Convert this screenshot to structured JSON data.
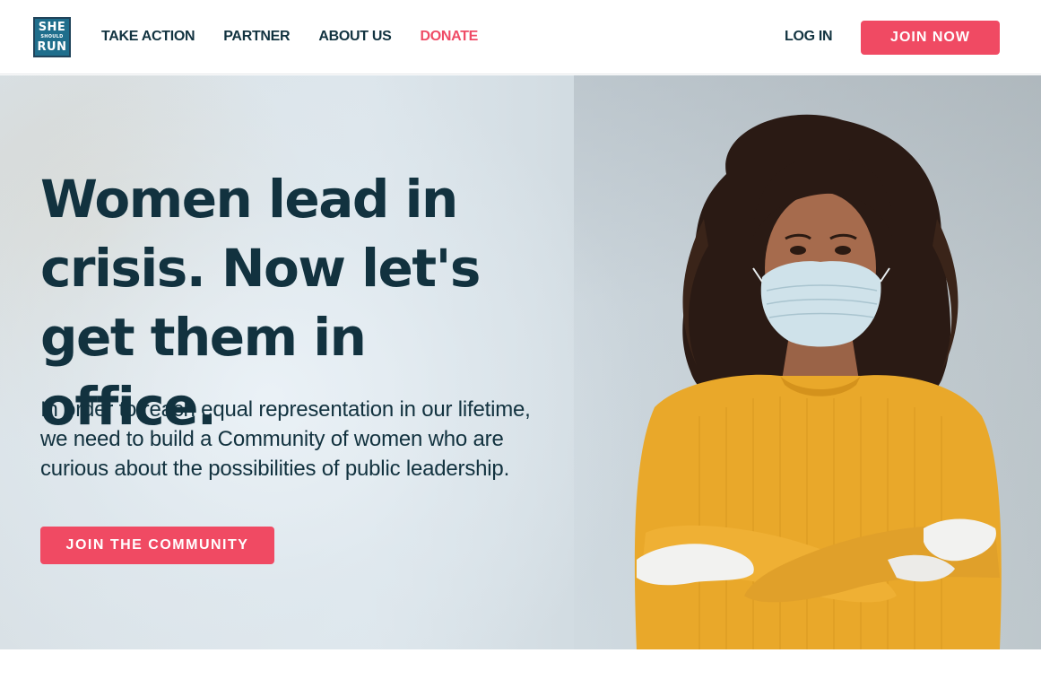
{
  "logo": {
    "line1": "SHE",
    "line2": "SHOULD",
    "line3": "RUN"
  },
  "nav": {
    "take_action": "TAKE ACTION",
    "partner": "PARTNER",
    "about_us": "ABOUT US",
    "donate": "DONATE"
  },
  "header": {
    "login": "LOG IN",
    "join_now": "JOIN NOW"
  },
  "hero": {
    "headline": "Women lead in crisis. Now let's get them in office.",
    "subtext": "In order to reach equal representation in our lifetime, we need to build a Community of women who are curious about the possibilities of public leadership.",
    "cta": "JOIN THE COMMUNITY"
  },
  "colors": {
    "brand_pink": "#f04a63",
    "navy_text": "#12323f",
    "logo_blue": "#1f6e8c",
    "sweater_yellow": "#e9a82a"
  }
}
